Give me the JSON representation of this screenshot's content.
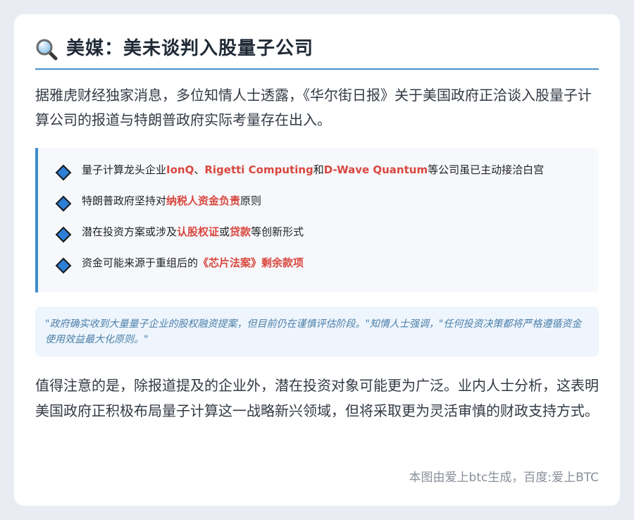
{
  "header": {
    "icon": "magnifier-icon",
    "title": "美媒：美未谈判入股量子公司"
  },
  "intro": "据雅虎财经独家消息，多位知情人士透露，《华尔街日报》关于美国政府正洽谈入股量子计算公司的报道与特朗普政府实际考量存在出入。",
  "bullets": [
    {
      "pre": "量子计算龙头企业",
      "h1": "IonQ",
      "mid1": "、",
      "h2": "Rigetti Computing",
      "mid2": "和",
      "h3": "D-Wave Quantum",
      "post": "等公司虽已主动接洽白宫"
    },
    {
      "pre": "特朗普政府坚持对",
      "h1": "纳税人资金负责",
      "post": "原则"
    },
    {
      "pre": "潜在投资方案或涉及",
      "h1": "认股权证",
      "mid1": "或",
      "h2": "贷款",
      "post": "等创新形式"
    },
    {
      "pre": "资金可能来源于重组后的",
      "h1": "《芯片法案》剩余款项"
    }
  ],
  "quote": "\"政府确实收到大量量子企业的股权融资提案，但目前仍在谨慎评估阶段。\"知情人士强调，\"任何投资决策都将严格遵循资金使用效益最大化原则。\"",
  "conclusion": "值得注意的是，除报道提及的企业外，潜在投资对象可能更为广泛。业内人士分析，这表明美国政府正积极布局量子计算这一战略新兴领域，但将采取更为灵活审慎的财政支持方式。",
  "footer": "本图由爱上btc生成，百度:爱上BTC",
  "colors": {
    "accent": "#3f8ccb",
    "highlight": "#d9473f",
    "quote_text": "#4b7faa",
    "background": "#e9ecf2"
  }
}
